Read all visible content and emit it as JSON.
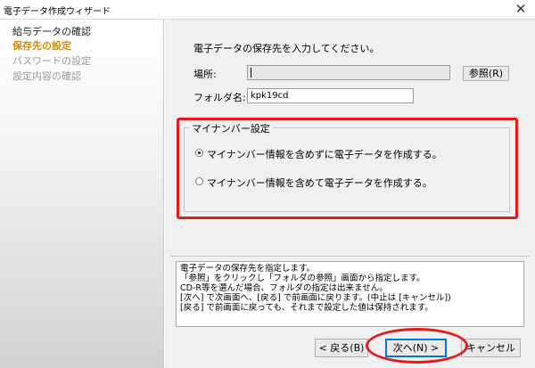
{
  "window": {
    "title": "電子データ作成ウィザード",
    "close_glyph": "✕"
  },
  "sidebar": {
    "steps": [
      {
        "label": "給与データの確認",
        "state": "done"
      },
      {
        "label": "保存先の設定",
        "state": "current"
      },
      {
        "label": "パスワードの設定",
        "state": "pending"
      },
      {
        "label": "設定内容の確認",
        "state": "pending"
      }
    ]
  },
  "main": {
    "instruction": "電子データの保存先を入力してください。",
    "location_label": "場所:",
    "location_value": "",
    "browse_label": "参照(R)",
    "folder_label": "フォルダ名:",
    "folder_value": "kpk19cd"
  },
  "mynumber": {
    "legend": "マイナンバー設定",
    "options": [
      {
        "label": "マイナンバー情報を含めずに電子データを作成する。",
        "selected": true
      },
      {
        "label": "マイナンバー情報を含めて電子データを作成する。",
        "selected": false
      }
    ]
  },
  "info": {
    "lines": [
      "電子データの保存先を指定します。",
      "「参照」をクリックし「フォルダの参照」画面から指定します。",
      "CD-R等を選んだ場合、フォルダの指定は出来ません。",
      "[次へ] で次画面へ、[戻る] で前画面に戻ります。(中止は [キャンセル])",
      "[戻る] で前画面に戻っても、それまで設定した値は保持されます。"
    ]
  },
  "buttons": {
    "back": "< 戻る(B)",
    "next": "次へ(N) >",
    "cancel": "キャンセル"
  },
  "colors": {
    "highlight": "#e41b1b",
    "current_step": "#d98a00",
    "focus": "#0078d7"
  }
}
